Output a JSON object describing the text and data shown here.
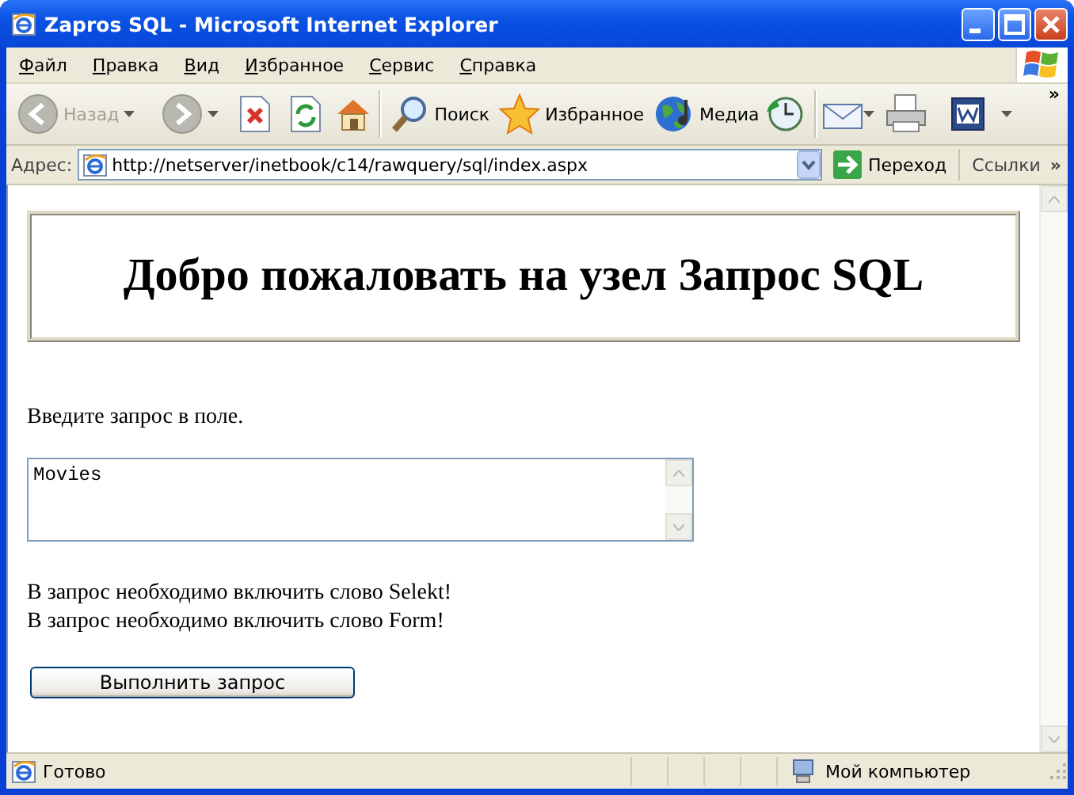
{
  "window": {
    "title": "Zapros SQL - Microsoft Internet Explorer"
  },
  "menu": [
    "Файл",
    "Правка",
    "Вид",
    "Избранное",
    "Сервис",
    "Справка"
  ],
  "toolbar": {
    "back": {
      "label": "Назад",
      "disabled": true
    },
    "forward": {
      "disabled": true
    },
    "search": {
      "label": "Поиск"
    },
    "favorites": {
      "label": "Избранное"
    },
    "media": {
      "label": "Медиа"
    },
    "more": "»"
  },
  "address_bar": {
    "label": "Адрес:",
    "url": "http://netserver/inetbook/c14/rawquery/sql/index.aspx",
    "go": "Переход",
    "links": "Ссылки",
    "more": "»"
  },
  "page": {
    "heading": "Добро пожаловать на узел Запрос SQL",
    "prompt": "Введите запрос в поле.",
    "query": "Movies",
    "messages": [
      "В запрос необходимо включить слово Selekt!",
      "В запрос необходимо включить слово Form!"
    ],
    "submit": "Выполнить запрос"
  },
  "status_bar": {
    "text": "Готово",
    "zone": "Мой компьютер"
  }
}
